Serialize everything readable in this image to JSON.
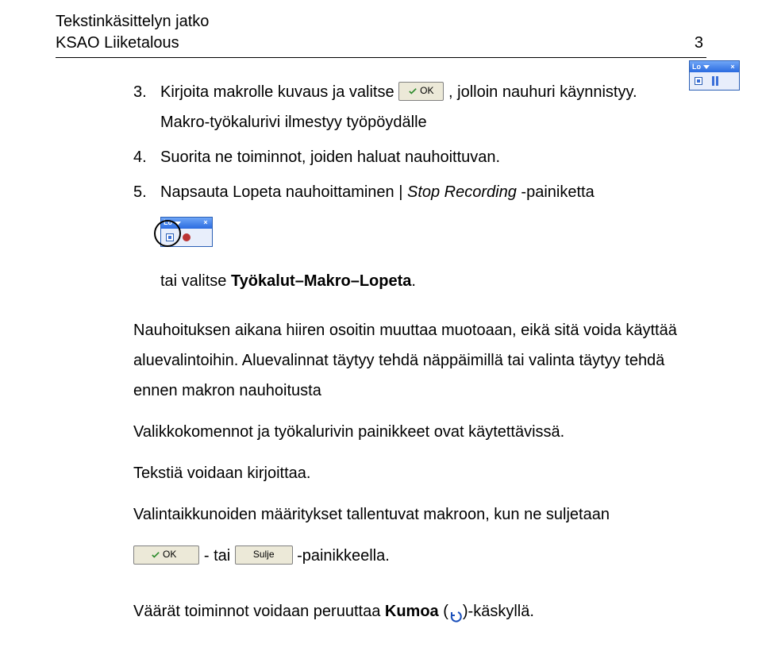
{
  "header": {
    "line1": "Tekstinkäsittelyn jatko",
    "line2": "KSAO Liiketalous",
    "page_number": "3"
  },
  "buttons": {
    "ok": "OK",
    "sulje": "Sulje"
  },
  "toolbar": {
    "title": "Lo"
  },
  "list": {
    "item3_num": "3.",
    "item3_a": "Kirjoita makrolle kuvaus ja valitse ",
    "item3_b": ", jolloin nauhuri käynnistyy. Makro-työkalurivi ilmestyy työpöydälle",
    "item4_num": "4.",
    "item4_text": "Suorita ne toiminnot, joiden haluat nauhoittuvan.",
    "item5_num": "5.",
    "item5_a": "Napsauta Lopeta nauhoittaminen | ",
    "item5_italic": "Stop Recording",
    "item5_b": " -painiketta",
    "item5_c_a": "tai valitse ",
    "item5_c_bold": "Työkalut–Makro–Lopeta",
    "item5_c_b": "."
  },
  "paras": {
    "p1": "Nauhoituksen aikana hiiren osoitin muuttaa muotoaan, eikä sitä voida käyttää aluevalintoihin. Aluevalinnat täytyy tehdä näppäimillä tai valinta täytyy tehdä ennen makron nauhoitusta",
    "p2": "Valikkokomennot ja työkalurivin painikkeet ovat käytettävissä.",
    "p3": "Tekstiä voidaan kirjoittaa.",
    "p4": "Valintaikkunoiden määritykset tallentuvat makroon, kun ne suljetaan",
    "p5_a": "- tai ",
    "p5_b": "-painikkeella.",
    "p6_a": "Väärät toiminnot voidaan peruuttaa ",
    "p6_bold": "Kumoa",
    "p6_b": " (",
    "p6_c": ")-käskyllä."
  }
}
